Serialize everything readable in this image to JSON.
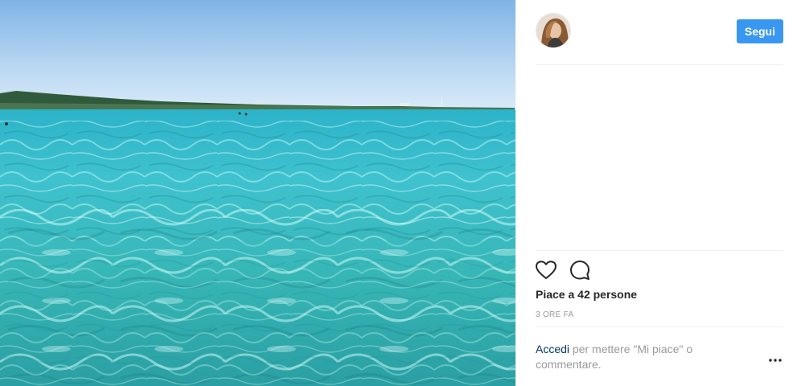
{
  "header": {
    "follow_label": "Segui"
  },
  "actions": {
    "like_icon": "heart-icon",
    "comment_icon": "comment-icon",
    "more_icon": "more-options-icon"
  },
  "stats": {
    "likes_text": "Piace a 42 persone",
    "time_text": "3 ORE FA"
  },
  "login_prompt": {
    "link_text": "Accedi",
    "rest_text": " per mettere \"Mi piace\" o commentare."
  },
  "colors": {
    "accent": "#3897f0",
    "link": "#003569",
    "muted": "#999999",
    "text": "#262626"
  }
}
